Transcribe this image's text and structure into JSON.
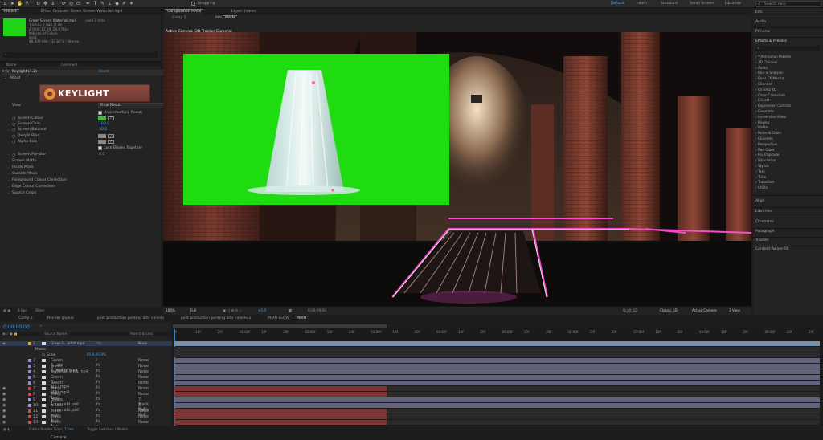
{
  "toolbar": {
    "checkbox_label": "Snapping",
    "workspaces": [
      "Default",
      "Learn",
      "Standard",
      "Small Screen",
      "Libraries"
    ],
    "search_placeholder": "Search Help"
  },
  "project": {
    "tab": "Project",
    "effect_controls_tab": "Effect Controls: Green Screen Waterfall.mp4",
    "file_name": "Green Screen Waterfall.mp4",
    "file_used": "used 1 time",
    "dims": "1,920 x 1,080 (1.00)",
    "duration": "Δ 0;00;12;29, 29.97 fps",
    "colors": "Millions of Colors",
    "codec": "avc1",
    "audio": "48,000 kHz / 32 bit U / Stereo",
    "search_icon": "⌕",
    "col_name": "Name",
    "col_comment": "Comment"
  },
  "effects": {
    "effect_name": "Keylight (1.2)",
    "reset": "Reset",
    "about": "About",
    "logo_text": "KEYLIGHT",
    "view_label": "View",
    "view_value": "Final Result",
    "unpremultiply": "Unpremultiply Result",
    "screen_colour": "Screen Colour",
    "screen_gain": "Screen Gain",
    "screen_gain_val": "100.0",
    "screen_balance": "Screen Balance",
    "screen_balance_val": "50.0",
    "despill_bias": "Despill Bias",
    "alpha_bias": "Alpha Bias",
    "lock_biases": "Lock Biases Together",
    "screen_preblur": "Screen Pre-blur",
    "screen_preblur_val": "0.0",
    "sections": [
      "Screen Matte",
      "Inside Mask",
      "Outside Mask",
      "Foreground Colour Correction",
      "Edge Colour Correction",
      "Source Crops"
    ],
    "footer": "8 bpc",
    "footer_time": "Dtzer"
  },
  "comp": {
    "title": "Composition MAIN",
    "layer_tab": "Layer: (none)",
    "sub_tabs": [
      "Comp 2",
      "MAIN SLOW",
      "MAIN"
    ],
    "camera": "Active Camera (3D Tracker Camera)",
    "zoom": "100%",
    "resolution": "Full",
    "timecode": "0;00;09;00",
    "plus_val": "+0.0",
    "renderer": "Draft 3D",
    "renderer_mode": "Classic 3D",
    "view_camera": "Active Camera",
    "views": "1 View"
  },
  "right_panel": {
    "top_items": [
      "Info",
      "Audio",
      "Preview",
      "Effects & Presets"
    ],
    "fx_list": [
      "* Animation Presets",
      "3D Channel",
      "Audio",
      "Blur & Sharpen",
      "Boris FX Mocha",
      "Channel",
      "Cinema 4D",
      "Color Correction",
      "Distort",
      "Expression Controls",
      "Generate",
      "Immersive Video",
      "Keying",
      "Matte",
      "Noise & Grain",
      "Obsolete",
      "Perspective",
      "Red Giant",
      "RG Trapcode",
      "Simulation",
      "Stylize",
      "Text",
      "Time",
      "Transition",
      "Utility"
    ],
    "bottom_items": [
      "Align",
      "Libraries",
      "Character",
      "Paragraph",
      "Tracker",
      "Content-Aware Fill"
    ]
  },
  "timeline": {
    "tabs": [
      "Comp 2",
      "Render Queue",
      "post production penting arts vaiselo",
      "post production penting arts vaiselo 2",
      "MAIN SLOW",
      "MAIN"
    ],
    "time": "0:00:00:00",
    "col_source": "Source Name",
    "col_parent": "Parent & Link",
    "ruler": [
      "0f",
      "10f",
      "20f",
      "01:00f",
      "10f",
      "20f",
      "02:00f",
      "10f",
      "20f",
      "03:00f",
      "10f",
      "20f",
      "04:00f",
      "10f",
      "20f",
      "05:00f",
      "10f",
      "20f",
      "06:00f",
      "10f",
      "20f",
      "07:00f",
      "10f",
      "20f",
      "08:00f",
      "10f",
      "20f",
      "09:00f",
      "10f",
      "20f"
    ],
    "masks_label": "Masks",
    "scale_label": "Scale",
    "scale_val": "85.0,85.0%",
    "layers": [
      {
        "num": "1",
        "name": "Green S...erfall.mp4",
        "parent": "None",
        "color": "#d9a53a"
      },
      {
        "num": "2",
        "name": "Green S...ste 2.mp4",
        "parent": "None",
        "color": "#8f8fd6"
      },
      {
        "num": "3",
        "name": "green s...ducts.mp4",
        "parent": "None",
        "color": "#8f8fd6"
      },
      {
        "num": "4",
        "name": "waterfall.wfta.mp4",
        "parent": "None",
        "color": "#8f8fd6"
      },
      {
        "num": "5",
        "name": "Green S...(11).mp4",
        "parent": "None",
        "color": "#8f8fd6"
      },
      {
        "num": "6",
        "name": "Green S...(11).mp4",
        "parent": "None",
        "color": "#8f8fd6"
      },
      {
        "num": "7",
        "name": "Track Null 1",
        "parent": "None",
        "color": "#c84a4a"
      },
      {
        "num": "8",
        "name": "Track Null 1",
        "parent": "None",
        "color": "#c84a4a"
      },
      {
        "num": "9",
        "name": "pikaso ...xxxxabi.psd",
        "parent": "7. Track Null",
        "color": "#9a9ad8"
      },
      {
        "num": "10",
        "name": "pikaso ...xxxxabi.psd",
        "parent": "8. Track Null",
        "color": "#9a9ad8"
      },
      {
        "num": "11",
        "name": "Track Null 1",
        "parent": "None",
        "color": "#c84a4a"
      },
      {
        "num": "12",
        "name": "Track Null 1",
        "parent": "None",
        "color": "#c84a4a"
      },
      {
        "num": "13",
        "name": "Track Null 1",
        "parent": "None",
        "color": "#c84a4a"
      },
      {
        "num": "14",
        "name": "3D Tracker Camera",
        "parent": "None",
        "color": "#c84a4a"
      }
    ],
    "footer_left": "Frame Render Time:",
    "footer_ms": "17ms",
    "footer_mid": "Toggle Switches / Modes"
  },
  "colors": {
    "accent": "#3b83d6",
    "key_green": "#1fdc11"
  }
}
